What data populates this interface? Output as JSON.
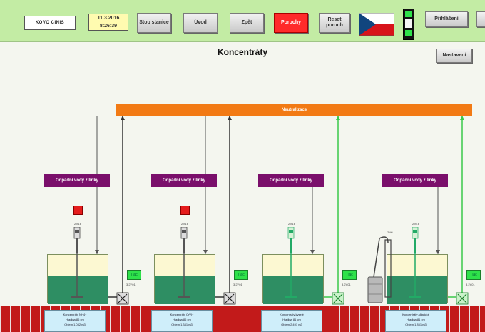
{
  "header": {
    "logo_text": "KOVO CINIS",
    "date": "11.3.2016",
    "time": "8:26:39",
    "buttons": {
      "stop": "Stop stanice",
      "home": "Úvod",
      "back": "Zpět",
      "faults": "Poruchy",
      "reset": "Reset poruch",
      "login": "Přihlášení"
    }
  },
  "page": {
    "title": "Koncentráty",
    "settings_label": "Nastavení"
  },
  "neutralization_label": "Neutralizace",
  "colors": {
    "topbar": "#c3eca4",
    "neutral_bar": "#f27a14",
    "waste_box": "#7a0f6b",
    "fault_button": "#ff2a2a",
    "pipe_active": "#3ac94a",
    "pipe_idle": "#333333"
  },
  "stations": [
    {
      "waste_label": "Odpadní vody z linky",
      "motor_label": "2M16",
      "alarm": true,
      "green_btn": "Tlač",
      "valve_label": "3.2Y01",
      "info": [
        "Koncentráty NH4+",
        "Hladina 86 cm",
        "Objem 1,032 m3"
      ]
    },
    {
      "waste_label": "Odpadní vody z linky",
      "motor_label": "2M16",
      "alarm": true,
      "green_btn": "Tlač",
      "valve_label": "3.2Y01",
      "info": [
        "Koncentráty CrVI+",
        "Hladina 86 cm",
        "Objem 1,341 m3"
      ]
    },
    {
      "waste_label": "Odpadní vody z linky",
      "motor_label": "2M16",
      "alarm": false,
      "green_btn": "Tlač",
      "valve_label": "3.2Y01",
      "info": [
        "Koncentráty kyselé",
        "Hladina 81 cm",
        "Objem 2,491 m3"
      ]
    },
    {
      "waste_label": "Odpadní vody z linky",
      "motor_label": "2M16",
      "alarm": false,
      "green_btn": "Tlač",
      "valve_label": "3.2Y01",
      "info": [
        "Koncentráty alkalické",
        "Hladina 81 cm",
        "Objem 1,851 m3"
      ]
    }
  ],
  "extra_motor_label": "2M6",
  "icons": [
    "logo-icon",
    "czech-flag-icon",
    "semaphore-icon",
    "motor-icon",
    "valve-icon",
    "barrel-icon",
    "pump-icon"
  ]
}
